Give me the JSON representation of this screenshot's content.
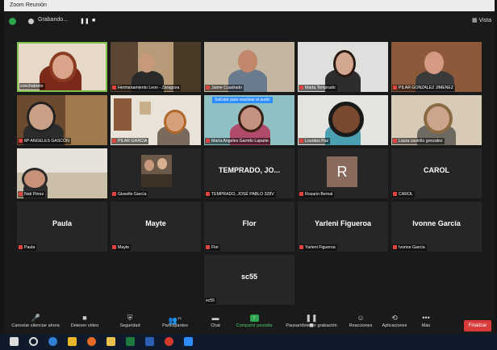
{
  "window": {
    "title": "Zoom Reunión",
    "view_label": "Vista"
  },
  "recording": {
    "status": "Grabando...",
    "pause_label": "❚❚",
    "stop_label": "■"
  },
  "notice": "Solicitar para reactivar el audio",
  "tiles": [
    {
      "name": "zonchabreto",
      "big": ""
    },
    {
      "name": "Hermanamiento Leon - Zaragoza",
      "big": ""
    },
    {
      "name": "Jaime Cuadrado",
      "big": ""
    },
    {
      "name": "Marta Temprado",
      "big": ""
    },
    {
      "name": "PILAR GONZALEZ JIMENEZ",
      "big": ""
    },
    {
      "name": "Mª ANGELES GASCÓN",
      "big": ""
    },
    {
      "name": "PILAR GRACIA",
      "big": ""
    },
    {
      "name": "María Angeles Garrido Laparte",
      "big": ""
    },
    {
      "name": "Lourdes Paz",
      "big": ""
    },
    {
      "name": "Laura castrillo gonzalez",
      "big": ""
    },
    {
      "name": "Nati Pérez",
      "big": ""
    },
    {
      "name": "Gisselle García",
      "big": ""
    },
    {
      "name": "TEMPRADO, JOSÉ PABLO 328V",
      "big": "TEMPRADO, JO..."
    },
    {
      "name": "Rosario Bernal",
      "big": "",
      "avatar": "R"
    },
    {
      "name": "CAROL",
      "big": "CAROL"
    },
    {
      "name": "Paula",
      "big": "Paula"
    },
    {
      "name": "Mayte",
      "big": "Mayte"
    },
    {
      "name": "Flor",
      "big": "Flor"
    },
    {
      "name": "Yarleni Figueroa",
      "big": "Yarleni Figueroa"
    },
    {
      "name": "Ivonne García",
      "big": "Ivonne García"
    },
    {
      "name": "sc55",
      "big": "sc55"
    }
  ],
  "toolbar": {
    "mute": "Cancelar silenciar ahora",
    "video": "Detener vídeo",
    "security": "Seguridad",
    "participants": "Participantes",
    "participants_count": "21",
    "chat": "Chat",
    "share": "Compartir pantalla",
    "record": "Pausar/detener grabación",
    "reactions": "Reacciones",
    "apps": "Aplicaciones",
    "more": "Más",
    "end": "Finalizar"
  }
}
